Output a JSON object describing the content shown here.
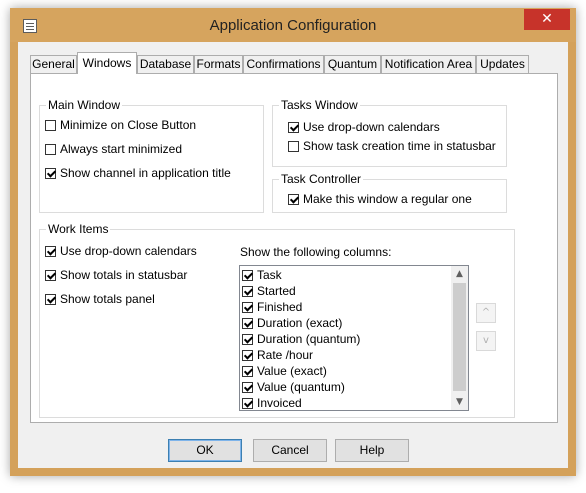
{
  "window": {
    "title": "Application Configuration",
    "close_glyph": "✕"
  },
  "tabs": [
    "General",
    "Windows",
    "Database",
    "Formats",
    "Confirmations",
    "Quantum",
    "Notification Area",
    "Updates"
  ],
  "active_tab": "Windows",
  "main_window": {
    "legend": "Main Window",
    "options": [
      {
        "label": "Minimize on Close Button",
        "checked": false
      },
      {
        "label": "Always start minimized",
        "checked": false
      },
      {
        "label": "Show channel in application title",
        "checked": true
      }
    ]
  },
  "tasks_window": {
    "legend": "Tasks Window",
    "options": [
      {
        "label": "Use drop-down calendars",
        "checked": true
      },
      {
        "label": "Show task creation time in statusbar",
        "checked": false
      }
    ]
  },
  "task_controller": {
    "legend": "Task Controller",
    "options": [
      {
        "label": "Make this window a regular one",
        "checked": true
      }
    ]
  },
  "work_items": {
    "legend": "Work Items",
    "options": [
      {
        "label": "Use drop-down calendars",
        "checked": true
      },
      {
        "label": "Show totals in statusbar",
        "checked": true
      },
      {
        "label": "Show totals panel",
        "checked": true
      }
    ],
    "columns_label": "Show the following columns:",
    "columns": [
      {
        "label": "Task",
        "checked": true
      },
      {
        "label": "Started",
        "checked": true
      },
      {
        "label": "Finished",
        "checked": true
      },
      {
        "label": "Duration (exact)",
        "checked": true
      },
      {
        "label": "Duration (quantum)",
        "checked": true
      },
      {
        "label": "Rate /hour",
        "checked": true
      },
      {
        "label": "Value (exact)",
        "checked": true
      },
      {
        "label": "Value (quantum)",
        "checked": true
      },
      {
        "label": "Invoiced",
        "checked": true
      }
    ],
    "move_up_glyph": "^",
    "move_down_glyph": "v",
    "scroll_up_glyph": "▲",
    "scroll_down_glyph": "▼"
  },
  "buttons": {
    "ok": "OK",
    "cancel": "Cancel",
    "help": "Help"
  },
  "colors": {
    "title_bar": "#d6a45e",
    "close_button": "#c7332a",
    "default_button_border": "#3c7fb1"
  }
}
